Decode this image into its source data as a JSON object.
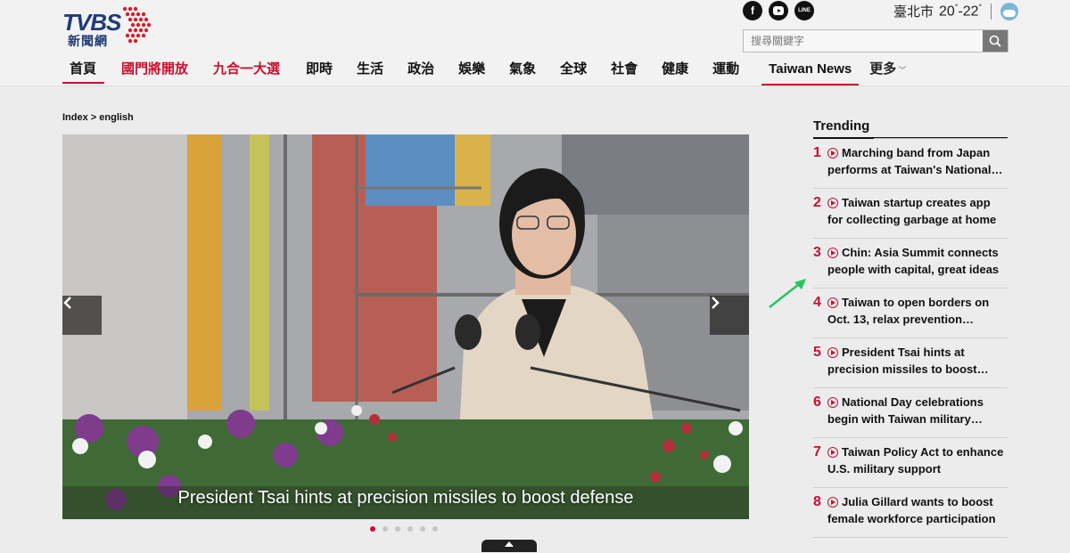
{
  "logo": {
    "brand": "TVBS",
    "sub": "新聞網"
  },
  "social": {
    "icons": [
      "facebook-icon",
      "youtube-icon",
      "line-icon"
    ],
    "line_label": "LINE"
  },
  "weather": {
    "city": "臺北市",
    "low": "20",
    "high": "22",
    "degree": "°",
    "dash": "-",
    "icon": "cloud-icon"
  },
  "search": {
    "placeholder": "搜尋關鍵字"
  },
  "nav": {
    "items": [
      {
        "label": "首頁",
        "active": true
      },
      {
        "label": "國門將開放",
        "red": true
      },
      {
        "label": "九合一大選",
        "red": true
      },
      {
        "label": "即時"
      },
      {
        "label": "生活"
      },
      {
        "label": "政治"
      },
      {
        "label": "娛樂"
      },
      {
        "label": "氣象"
      },
      {
        "label": "全球"
      },
      {
        "label": "社會"
      },
      {
        "label": "健康"
      },
      {
        "label": "運動"
      },
      {
        "label": "Taiwan News",
        "active": true
      },
      {
        "label": "更多"
      }
    ]
  },
  "breadcrumb": {
    "text": "Index > english"
  },
  "carousel": {
    "caption": "President Tsai hints at precision missiles to boost defense",
    "prev_icon": "chevron-left-icon",
    "next_icon": "chevron-right-icon",
    "slide_count": 6,
    "current_slide": 1
  },
  "trending": {
    "title": "Trending",
    "items": [
      {
        "num": "1",
        "text": "Marching band from Japan performs at Taiwan's National…"
      },
      {
        "num": "2",
        "text": "Taiwan startup creates app for collecting garbage at home"
      },
      {
        "num": "3",
        "text": "Chin: Asia Summit connects people with capital, great ideas"
      },
      {
        "num": "4",
        "text": "Taiwan to open borders on Oct. 13, relax prevention…"
      },
      {
        "num": "5",
        "text": "President Tsai hints at precision missiles to boost…"
      },
      {
        "num": "6",
        "text": "National Day celebrations begin with Taiwan military…"
      },
      {
        "num": "7",
        "text": "Taiwan Policy Act to enhance U.S. military support"
      },
      {
        "num": "8",
        "text": "Julia Gillard wants to boost female workforce participation"
      }
    ]
  },
  "colors": {
    "accent": "#c8102e",
    "brand": "#1f3b77",
    "annotation": "#22c55e"
  }
}
